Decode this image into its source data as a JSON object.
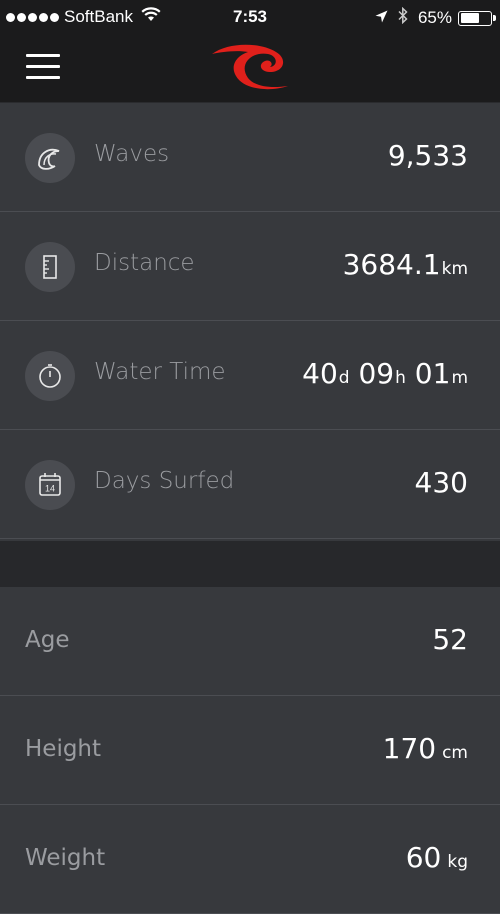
{
  "status_bar": {
    "carrier": "SoftBank",
    "time": "7:53",
    "battery": "65%",
    "battery_level": 0.65
  },
  "stats": [
    {
      "label": "Waves",
      "value": "9,533",
      "icon": "wave-icon"
    },
    {
      "label": "Distance",
      "value": "3684.1",
      "unit": "km",
      "icon": "ruler-icon"
    },
    {
      "label": "Water Time",
      "days": "40",
      "days_unit": "d",
      "hours": "09",
      "hours_unit": "h",
      "minutes": "01",
      "minutes_unit": "m",
      "icon": "stopwatch-icon"
    },
    {
      "label": "Days Surfed",
      "value": "430",
      "icon": "calendar-icon",
      "calendar_day": "14"
    }
  ],
  "profile": [
    {
      "label": "Age",
      "value": "52"
    },
    {
      "label": "Height",
      "value": "170",
      "unit": "cm"
    },
    {
      "label": "Weight",
      "value": "60",
      "unit": "kg"
    }
  ],
  "colors": {
    "accent": "#e0201b",
    "background": "#37393d",
    "header": "#1b1b1c",
    "label": "#9a9ca0"
  }
}
